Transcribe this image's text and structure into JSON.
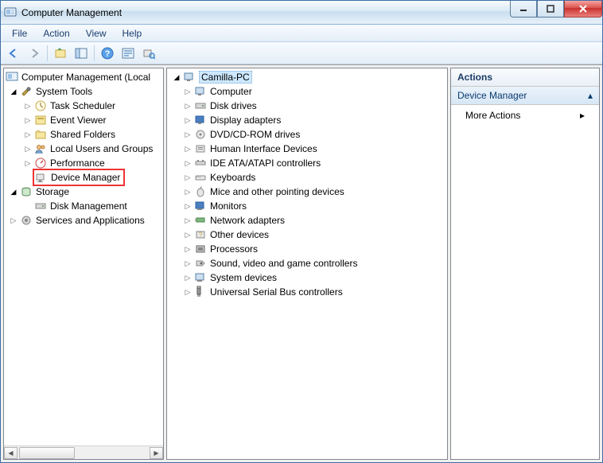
{
  "window": {
    "title": "Computer Management"
  },
  "menu": {
    "file": "File",
    "action": "Action",
    "view": "View",
    "help": "Help"
  },
  "tree_left": {
    "root": "Computer Management (Local",
    "system_tools": "System Tools",
    "task_scheduler": "Task Scheduler",
    "event_viewer": "Event Viewer",
    "shared_folders": "Shared Folders",
    "local_users": "Local Users and Groups",
    "performance": "Performance",
    "device_manager": "Device Manager",
    "storage": "Storage",
    "disk_management": "Disk Management",
    "services_apps": "Services and Applications"
  },
  "tree_mid": {
    "root": "Camilla-PC",
    "items": [
      "Computer",
      "Disk drives",
      "Display adapters",
      "DVD/CD-ROM drives",
      "Human Interface Devices",
      "IDE ATA/ATAPI controllers",
      "Keyboards",
      "Mice and other pointing devices",
      "Monitors",
      "Network adapters",
      "Other devices",
      "Processors",
      "Sound, video and game controllers",
      "System devices",
      "Universal Serial Bus controllers"
    ]
  },
  "actions": {
    "header": "Actions",
    "subheader": "Device Manager",
    "more": "More Actions"
  },
  "colors": {
    "highlight_border": "#e33",
    "selection_bg": "#cde8ff"
  }
}
